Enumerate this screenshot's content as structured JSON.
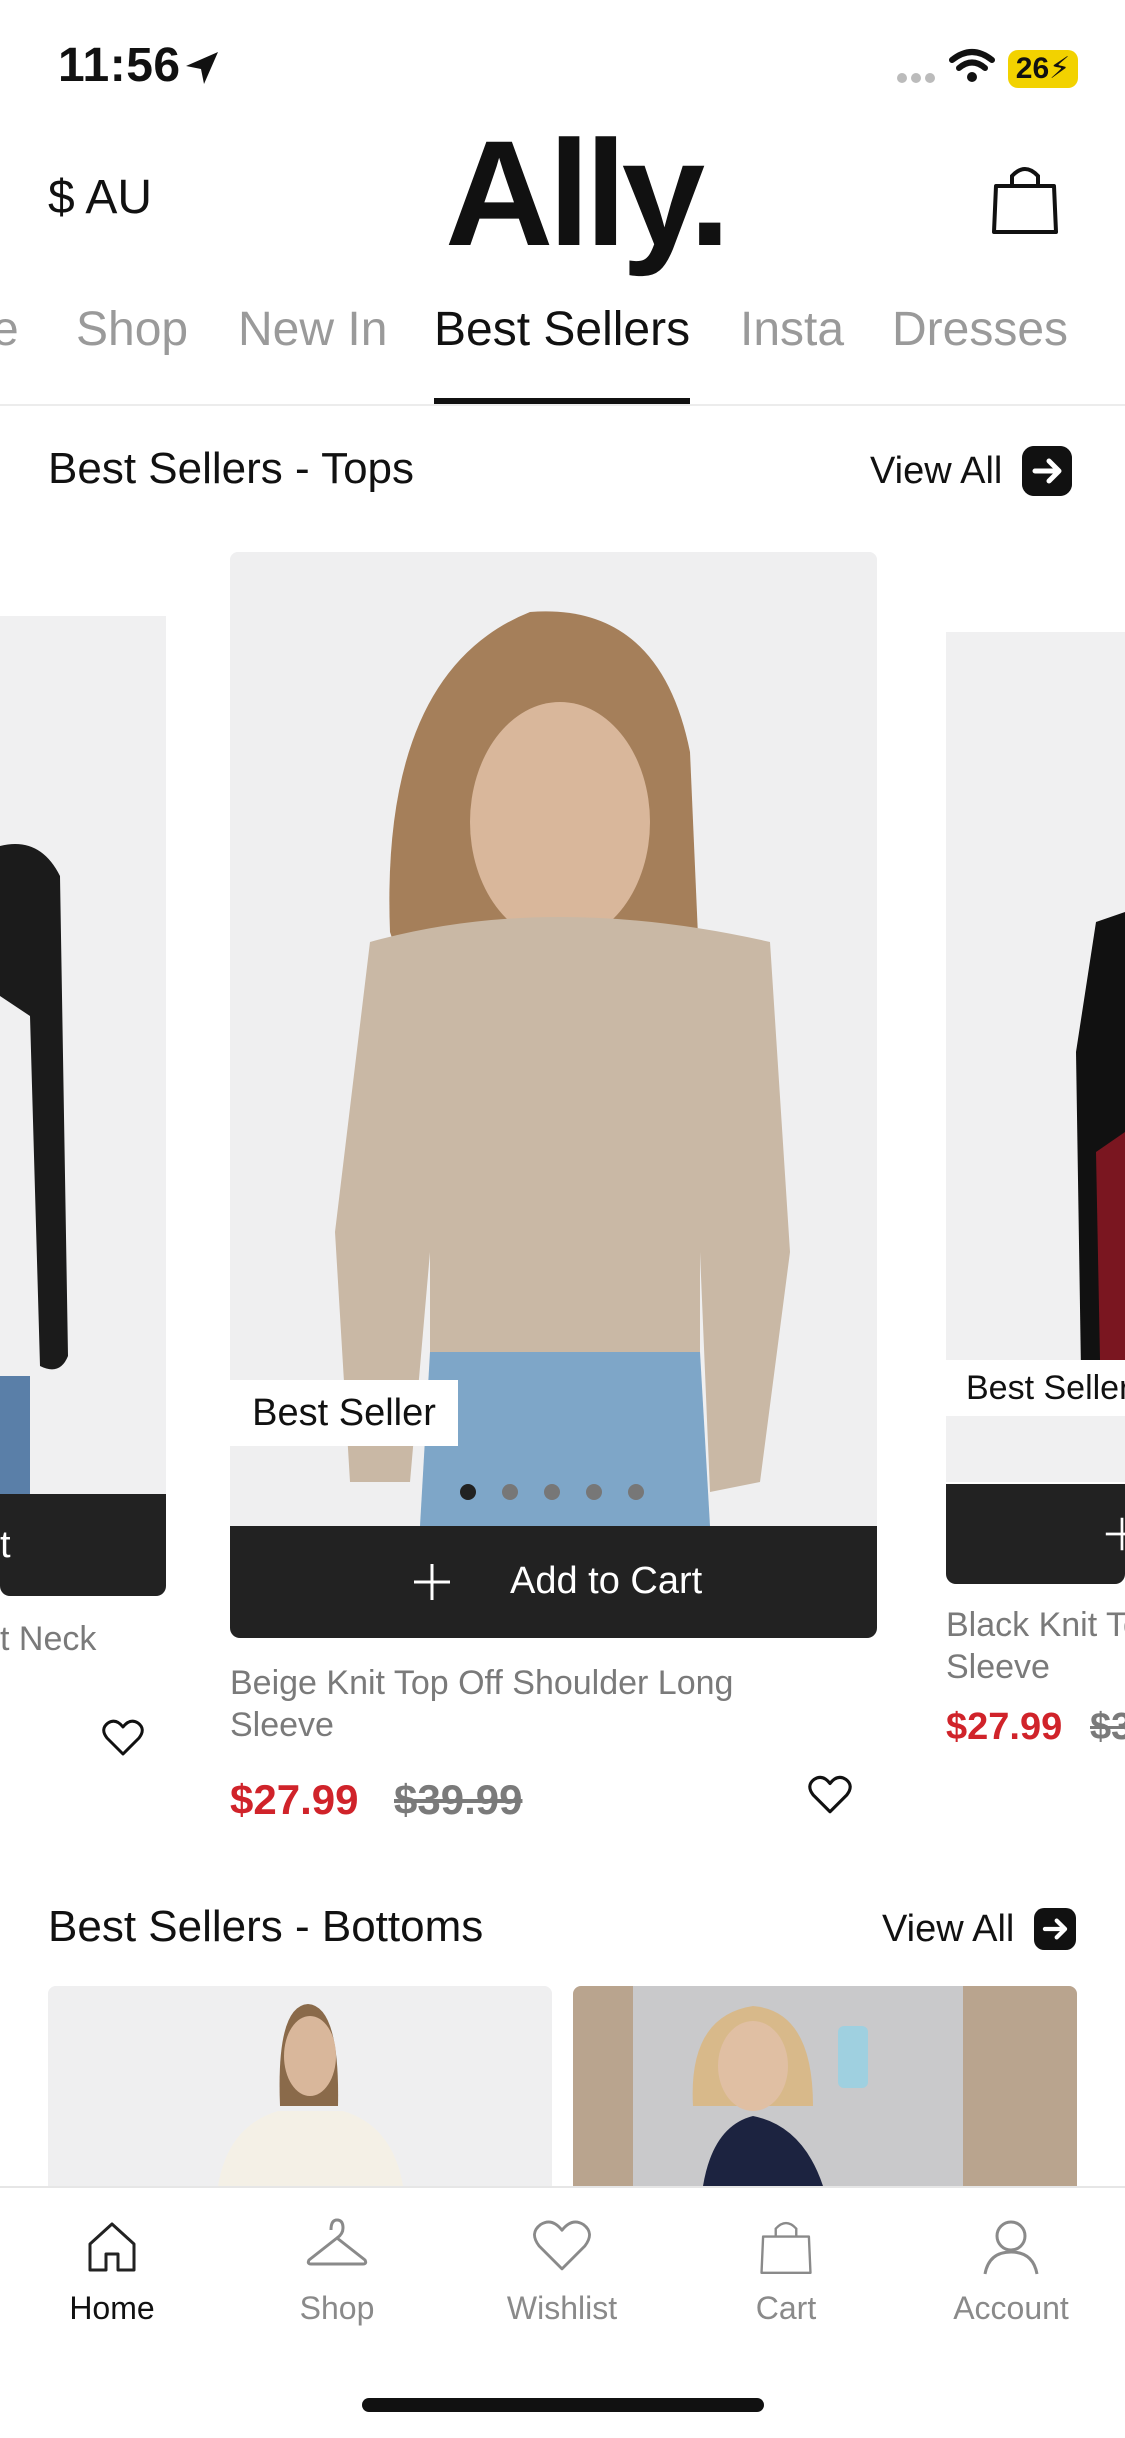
{
  "status_bar": {
    "time": "11:56",
    "battery": "26"
  },
  "header": {
    "currency": "$ AU",
    "logo": "Ally."
  },
  "tabs": [
    {
      "label": "e"
    },
    {
      "label": "Shop"
    },
    {
      "label": "New In"
    },
    {
      "label": "Best Sellers",
      "active": true
    },
    {
      "label": "Insta"
    },
    {
      "label": "Dresses"
    }
  ],
  "tops_section": {
    "title": "Best Sellers - Tops",
    "view_all": "View All",
    "cards": {
      "left": {
        "cart_partial": "t",
        "title_partial": "t Neck"
      },
      "center": {
        "badge": "Best Seller",
        "add_to_cart": "Add to Cart",
        "title": "Beige Knit Top Off Shoulder Long Sleeve",
        "price": "$27.99",
        "old_price": "$39.99"
      },
      "right": {
        "badge": "Best Seller",
        "title": "Black Knit To Sleeve",
        "price": "$27.99",
        "old_price": "$3"
      }
    }
  },
  "bottoms_section": {
    "title": "Best Sellers - Bottoms",
    "view_all": "View All"
  },
  "bottom_nav": [
    {
      "label": "Home",
      "active": true
    },
    {
      "label": "Shop"
    },
    {
      "label": "Wishlist"
    },
    {
      "label": "Cart"
    },
    {
      "label": "Account"
    }
  ],
  "colors": {
    "sale_red": "#d0232a",
    "dark": "#222222",
    "muted": "#9a9a9a",
    "battery": "#f2d200"
  }
}
